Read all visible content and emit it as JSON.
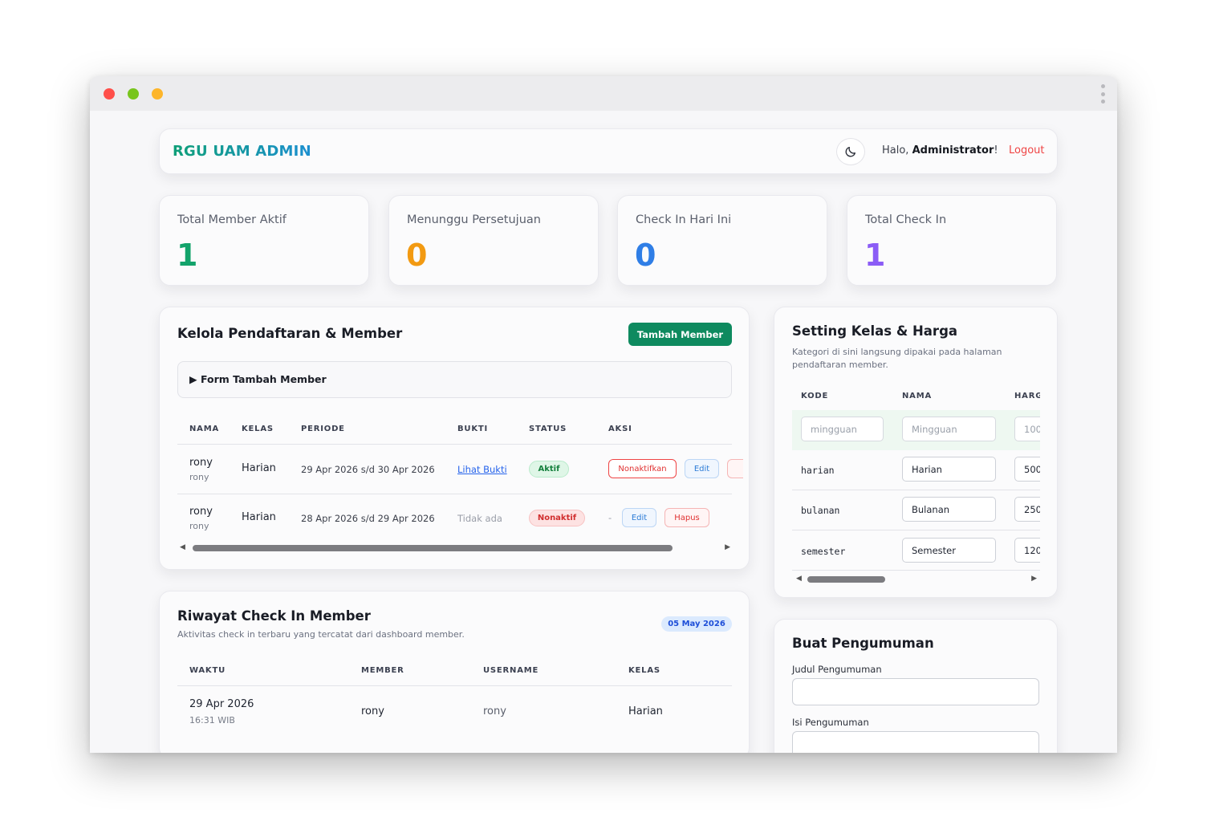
{
  "header": {
    "brand": "RGU UAM ADMIN",
    "greeting_prefix": "Halo, ",
    "user": "Administrator",
    "greeting_suffix": "!",
    "logout": "Logout",
    "theme_icon": "moon-icon"
  },
  "stats": [
    {
      "label": "Total Member Aktif",
      "value": "1",
      "color": "#13a36b"
    },
    {
      "label": "Menunggu Persetujuan",
      "value": "0",
      "color": "#f29a12"
    },
    {
      "label": "Check In Hari Ini",
      "value": "0",
      "color": "#2f7ee6"
    },
    {
      "label": "Total Check In",
      "value": "1",
      "color": "#8b5cf6"
    }
  ],
  "kelola": {
    "title": "Kelola Pendaftaran & Member",
    "add_button": "Tambah Member",
    "form_toggle": "▶  Form Tambah Member",
    "columns": [
      "NAMA",
      "KELAS",
      "PERIODE",
      "BUKTI",
      "STATUS",
      "AKSI"
    ],
    "rows": [
      {
        "name": "rony",
        "username": "rony",
        "kelas": "Harian",
        "periode": "29 Apr 2026 s/d 30 Apr 2026",
        "bukti": "Lihat Bukti",
        "status": "Aktif",
        "actions": [
          "Nonaktifkan",
          "Edit"
        ]
      },
      {
        "name": "rony",
        "username": "rony",
        "kelas": "Harian",
        "periode": "28 Apr 2026 s/d 29 Apr 2026",
        "bukti": "Tidak ada",
        "status": "Nonaktif",
        "dash": "-",
        "actions": [
          "Edit",
          "Hapus"
        ]
      }
    ]
  },
  "riwayat": {
    "title": "Riwayat Check In Member",
    "subtitle": "Aktivitas check in terbaru yang tercatat dari dashboard member.",
    "date_badge": "05 May 2026",
    "columns": [
      "WAKTU",
      "MEMBER",
      "USERNAME",
      "KELAS"
    ],
    "rows": [
      {
        "date": "29 Apr 2026",
        "time": "16:31 WIB",
        "member": "rony",
        "username": "rony",
        "kelas": "Harian"
      }
    ]
  },
  "setting": {
    "title": "Setting Kelas & Harga",
    "subtitle": "Kategori di sini langsung dipakai pada halaman pendaftaran member.",
    "columns": [
      "KODE",
      "NAMA",
      "HARG"
    ],
    "new_row": {
      "kode_placeholder": "mingguan",
      "nama_placeholder": "Mingguan",
      "harga_placeholder": "100"
    },
    "rows": [
      {
        "kode": "harian",
        "nama": "Harian",
        "harga": "500"
      },
      {
        "kode": "bulanan",
        "nama": "Bulanan",
        "harga": "250"
      },
      {
        "kode": "semester",
        "nama": "Semester",
        "harga": "120"
      }
    ]
  },
  "pengumuman": {
    "title": "Buat Pengumuman",
    "judul_label": "Judul Pengumuman",
    "isi_label": "Isi Pengumuman"
  }
}
